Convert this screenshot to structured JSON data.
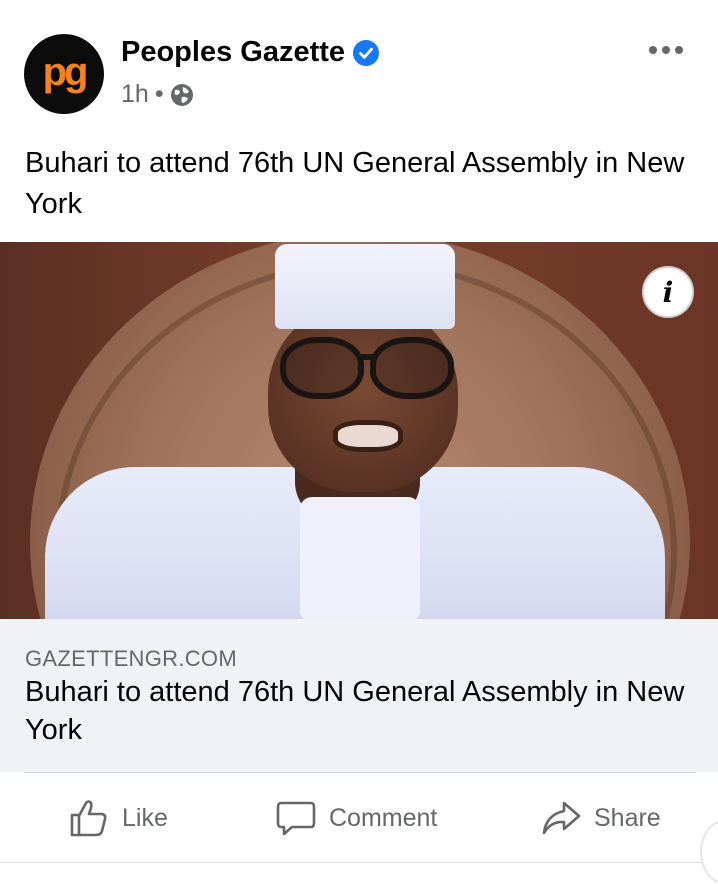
{
  "post": {
    "page_name": "Peoples Gazette",
    "avatar_text": "pg",
    "timestamp": "1h",
    "separator": "•",
    "text": "Buhari to attend 76th UN General Assembly in New York",
    "verified_icon": "verified-badge-icon",
    "privacy_icon": "globe-icon",
    "more_icon": "more-options-icon"
  },
  "link_preview": {
    "domain": "GAZETTENGR.COM",
    "title": "Buhari to attend 76th UN General Assembly in New York",
    "info_label": "i"
  },
  "actions": {
    "like_label": "Like",
    "comment_label": "Comment",
    "share_label": "Share"
  },
  "colors": {
    "brand_orange": "#f58220",
    "verified_blue": "#1877f2",
    "secondary_text": "#65676b",
    "preview_bg": "#f0f2f5"
  }
}
